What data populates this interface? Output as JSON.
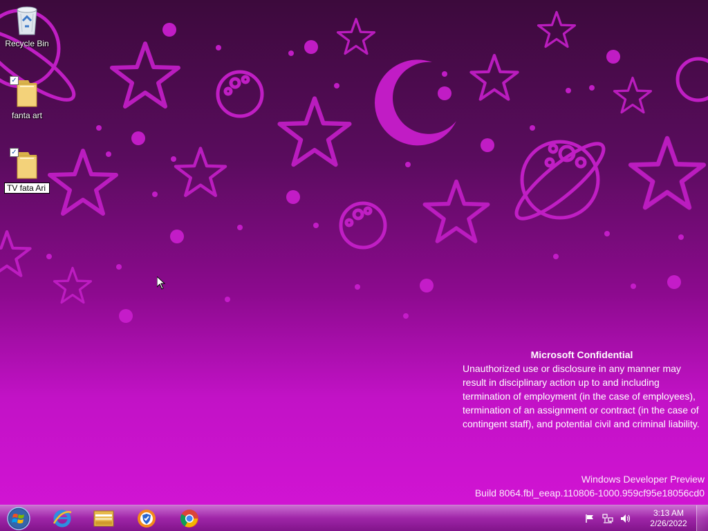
{
  "desktop": {
    "icons": [
      {
        "label": "Recycle Bin",
        "icon": "recycle-bin-icon"
      },
      {
        "label": "fanta art",
        "icon": "folder-icon",
        "checked": true
      },
      {
        "label": "TV  fata Ari",
        "icon": "folder-icon",
        "checked": true,
        "renaming": true
      }
    ]
  },
  "watermark": {
    "title": "Microsoft Confidential",
    "body": "Unauthorized use or disclosure in any manner may result in disciplinary action up to and including termination of employment (in the case of employees), termination of an assignment or contract (in the case of contingent staff), and potential civil and criminal liability."
  },
  "build": {
    "line1": "Windows Developer Preview",
    "line2": "Build 8064.fbl_eeap.110806-1000.959cf95e18056cd0"
  },
  "taskbar": {
    "start_icon": "windows-orb-icon",
    "pinned": [
      {
        "name": "internet-explorer",
        "icon": "internet-explorer-icon"
      },
      {
        "name": "file-explorer",
        "icon": "file-explorer-icon"
      },
      {
        "name": "browser-shield",
        "icon": "shield-browser-icon"
      },
      {
        "name": "chrome",
        "icon": "chrome-icon"
      }
    ],
    "tray": {
      "icons": [
        "action-center-flag-icon",
        "network-icon",
        "volume-icon"
      ],
      "time": "3:13 AM",
      "date": "2/26/2022"
    }
  },
  "colors": {
    "wallpaper_top": "#3c0a3c",
    "wallpaper_bottom": "#d414d6",
    "motif": "#c21ec6"
  }
}
